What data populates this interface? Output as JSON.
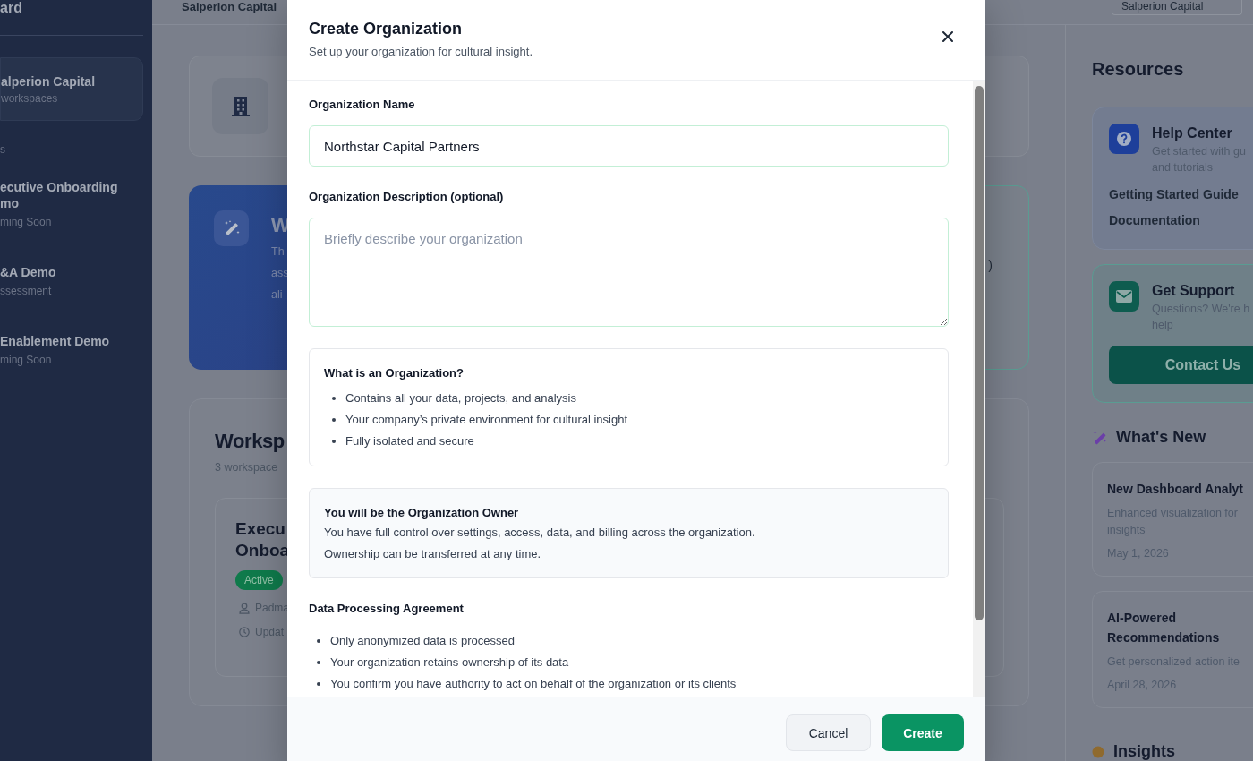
{
  "sidebar": {
    "title": "ard",
    "organization": {
      "name": "alperion Capital",
      "meta": "workspaces"
    },
    "section_label": "s",
    "items": [
      {
        "title": "ecutive Onboarding mo",
        "subtitle": "ming Soon"
      },
      {
        "title": "&A Demo",
        "subtitle": "ssessment"
      },
      {
        "title": "Enablement Demo",
        "subtitle": "ming Soon"
      }
    ]
  },
  "header": {
    "breadcrumb": "Salperion Capital",
    "org_select": "Salperion Capital"
  },
  "main": {
    "welcome": {
      "title": "W",
      "text": [
        "Th",
        "ass",
        "ali"
      ]
    },
    "side_card": {
      "text": ")"
    },
    "workspaces": {
      "title": "Worksp",
      "count": "3 workspace",
      "cards": [
        {
          "title": [
            "Execu",
            "Onboa"
          ],
          "status": "Active",
          "owner": "Padma",
          "updated": "Updat"
        }
      ]
    }
  },
  "resources": {
    "title": "Resources",
    "help": {
      "title": "Help Center",
      "description": [
        "Get started with gu",
        "and tutorials"
      ],
      "links": [
        "Getting Started Guide",
        "Documentation"
      ]
    },
    "support": {
      "title": "Get Support",
      "description": [
        "Questions? We're h",
        "help"
      ],
      "button": "Contact Us"
    }
  },
  "whats_new": {
    "title": "What's New",
    "items": [
      {
        "title": [
          "New Dashboard Analyt"
        ],
        "description": [
          "Enhanced visualization for",
          "insights"
        ],
        "date": "May 1, 2026"
      },
      {
        "title": [
          "AI-Powered",
          "Recommendations"
        ],
        "description": [
          "Get personalized action ite"
        ],
        "date": "April 28, 2026"
      }
    ]
  },
  "insights": {
    "title": "Insights"
  },
  "modal": {
    "title": "Create Organization",
    "subtitle": "Set up your organization for cultural insight.",
    "fields": [
      {
        "kind": "text",
        "label": "Organization Name",
        "value": "Northstar Capital Partners"
      },
      {
        "kind": "textarea",
        "label": "Organization Description (optional)",
        "placeholder": "Briefly describe your organization"
      }
    ],
    "info": {
      "title": "What is an Organization?",
      "items": [
        "Contains all your data, projects, and analysis",
        "Your company’s private environment for cultural insight",
        "Fully isolated and secure"
      ]
    },
    "owner": {
      "title": "You will be the Organization Owner",
      "lines": [
        "You have full control over settings, access, data, and billing across the organization.",
        "Ownership can be transferred at any time."
      ]
    },
    "agreement": {
      "title": "Data Processing Agreement",
      "items": [
        "Only anonymized data is processed",
        "Your organization retains ownership of its data",
        "You confirm you have authority to act on behalf of the organization or its clients"
      ]
    },
    "buttons": [
      {
        "kind": "secondary",
        "label": "Cancel"
      },
      {
        "kind": "primary",
        "label": "Create"
      }
    ]
  }
}
